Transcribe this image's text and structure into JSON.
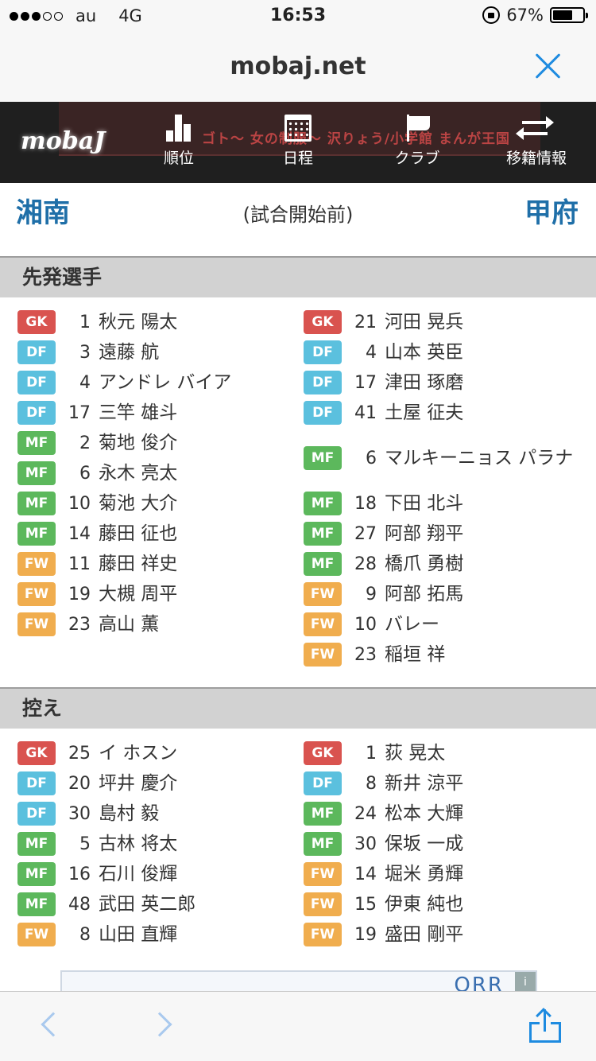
{
  "status_bar": {
    "carrier": "au",
    "network": "4G",
    "time": "16:53",
    "battery": "67%",
    "signal_dots_filled": 3,
    "signal_dots_total": 5,
    "battery_level": 0.67
  },
  "browser": {
    "url": "mobaj.net"
  },
  "site_nav": {
    "logo": "mobaJ",
    "banner_text": "ゴト～ 女の制服～ 沢りょう/小学館 まんが王国",
    "items": [
      {
        "label": "順位",
        "icon": "bar-chart-icon"
      },
      {
        "label": "日程",
        "icon": "calendar-icon"
      },
      {
        "label": "クラブ",
        "icon": "flag-icon"
      },
      {
        "label": "移籍情報",
        "icon": "transfer-icon"
      }
    ]
  },
  "match": {
    "home": "湘南",
    "away": "甲府",
    "status": "(試合開始前)"
  },
  "starters": {
    "title": "先発選手",
    "home": [
      {
        "pos": "GK",
        "num": "1",
        "name": "秋元 陽太"
      },
      {
        "pos": "DF",
        "num": "3",
        "name": "遠藤 航"
      },
      {
        "pos": "DF",
        "num": "4",
        "name": "アンドレ バイア"
      },
      {
        "pos": "DF",
        "num": "17",
        "name": "三竿 雄斗"
      },
      {
        "pos": "MF",
        "num": "2",
        "name": "菊地 俊介"
      },
      {
        "pos": "MF",
        "num": "6",
        "name": "永木 亮太"
      },
      {
        "pos": "MF",
        "num": "10",
        "name": "菊池 大介"
      },
      {
        "pos": "MF",
        "num": "14",
        "name": "藤田 征也"
      },
      {
        "pos": "FW",
        "num": "11",
        "name": "藤田 祥史"
      },
      {
        "pos": "FW",
        "num": "19",
        "name": "大槻 周平"
      },
      {
        "pos": "FW",
        "num": "23",
        "name": "高山 薫"
      }
    ],
    "away": [
      {
        "pos": "GK",
        "num": "21",
        "name": "河田 晃兵"
      },
      {
        "pos": "DF",
        "num": "4",
        "name": "山本 英臣"
      },
      {
        "pos": "DF",
        "num": "17",
        "name": "津田 琢磨"
      },
      {
        "pos": "DF",
        "num": "41",
        "name": "土屋 征夫"
      },
      {
        "pos": "MF",
        "num": "6",
        "name": "マルキーニョス パラナ"
      },
      {
        "pos": "MF",
        "num": "18",
        "name": "下田 北斗"
      },
      {
        "pos": "MF",
        "num": "27",
        "name": "阿部 翔平"
      },
      {
        "pos": "MF",
        "num": "28",
        "name": "橋爪 勇樹"
      },
      {
        "pos": "FW",
        "num": "9",
        "name": "阿部 拓馬"
      },
      {
        "pos": "FW",
        "num": "10",
        "name": "バレー"
      },
      {
        "pos": "FW",
        "num": "23",
        "name": "稲垣 祥"
      }
    ]
  },
  "substitutes": {
    "title": "控え",
    "home": [
      {
        "pos": "GK",
        "num": "25",
        "name": "イ ホスン"
      },
      {
        "pos": "DF",
        "num": "20",
        "name": "坪井 慶介"
      },
      {
        "pos": "DF",
        "num": "30",
        "name": "島村 毅"
      },
      {
        "pos": "MF",
        "num": "5",
        "name": "古林 将太"
      },
      {
        "pos": "MF",
        "num": "16",
        "name": "石川 俊輝"
      },
      {
        "pos": "MF",
        "num": "48",
        "name": "武田 英二郎"
      },
      {
        "pos": "FW",
        "num": "8",
        "name": "山田 直輝"
      }
    ],
    "away": [
      {
        "pos": "GK",
        "num": "1",
        "name": "荻 晃太"
      },
      {
        "pos": "DF",
        "num": "8",
        "name": "新井 涼平"
      },
      {
        "pos": "MF",
        "num": "24",
        "name": "松本 大輝"
      },
      {
        "pos": "MF",
        "num": "30",
        "name": "保坂 一成"
      },
      {
        "pos": "FW",
        "num": "14",
        "name": "堀米 勇輝"
      },
      {
        "pos": "FW",
        "num": "15",
        "name": "伊東 純也"
      },
      {
        "pos": "FW",
        "num": "19",
        "name": "盛田 剛平"
      }
    ]
  },
  "ad": {
    "text": "ORR",
    "info": "i"
  },
  "colors": {
    "GK": "#d9534f",
    "DF": "#5bc0de",
    "MF": "#5cb85c",
    "FW": "#f0ad4e",
    "team": "#1f6fa8",
    "ios_blue": "#1e8be0"
  }
}
